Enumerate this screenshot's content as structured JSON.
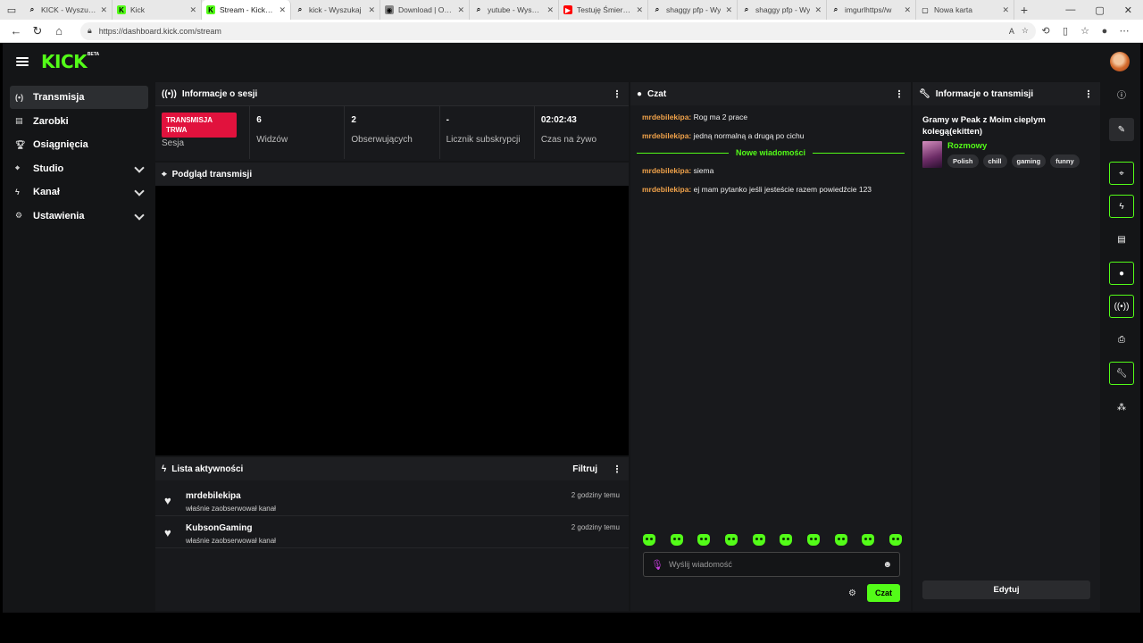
{
  "browser": {
    "tabs": [
      {
        "title": "KICK - Wyszukaj",
        "favicon": "search-icon",
        "color": "#e8e8e8"
      },
      {
        "title": "Kick",
        "favicon": "kick-logo",
        "color": "#53fc18"
      },
      {
        "title": "Stream - Kick Da",
        "favicon": "kick-logo",
        "color": "#53fc18",
        "active": true
      },
      {
        "title": "kick - Wyszukaj",
        "favicon": "search-icon",
        "color": "#e8e8e8"
      },
      {
        "title": "Download | OBS",
        "favicon": "obs-icon",
        "color": "#888888"
      },
      {
        "title": "yutube - Wyszuk",
        "favicon": "search-icon",
        "color": "#e8e8e8"
      },
      {
        "title": "Testuję Śmierci z",
        "favicon": "youtube-icon",
        "color": "#ff0000"
      },
      {
        "title": "shaggy pfp - Wy",
        "favicon": "search-icon",
        "color": "#e8e8e8"
      },
      {
        "title": "shaggy pfp - Wy",
        "favicon": "search-icon",
        "color": "#e8e8e8"
      },
      {
        "title": "imgurlhttps//w",
        "favicon": "search-icon",
        "color": "#e8e8e8"
      },
      {
        "title": "Nowa karta",
        "favicon": "new-tab-icon",
        "color": "#e8e8e8"
      }
    ],
    "url": "https://dashboard.kick.com/stream"
  },
  "logo": {
    "word": "KICK",
    "badge": "BETA"
  },
  "sidebar": {
    "items": [
      {
        "label": "Transmisja",
        "icon": "broadcast-icon",
        "active": true,
        "expandable": false
      },
      {
        "label": "Zarobki",
        "icon": "earnings-icon",
        "active": false,
        "expandable": false
      },
      {
        "label": "Osiągnięcia",
        "icon": "trophy-icon",
        "active": false,
        "expandable": false
      },
      {
        "label": "Studio",
        "icon": "studio-icon",
        "active": false,
        "expandable": true
      },
      {
        "label": "Kanał",
        "icon": "channel-icon",
        "active": false,
        "expandable": true
      },
      {
        "label": "Ustawienia",
        "icon": "settings-icon",
        "active": false,
        "expandable": true
      }
    ]
  },
  "session": {
    "title": "Informacje o sesji",
    "live_badge": "TRANSMISJA TRWA",
    "session_label": "Sesja",
    "stats": [
      {
        "value": "6",
        "label": "Widzów"
      },
      {
        "value": "2",
        "label": "Obserwujących"
      },
      {
        "value": "-",
        "label": "Licznik subskrypcji"
      },
      {
        "value": "02:02:43",
        "label": "Czas na żywo"
      }
    ]
  },
  "preview": {
    "title": "Podgląd transmisji"
  },
  "activity": {
    "title": "Lista aktywności",
    "filter_label": "Filtruj",
    "items": [
      {
        "name": "mrdebilekipa",
        "desc": "właśnie zaobserwował kanał",
        "time": "2 godziny temu"
      },
      {
        "name": "KubsonGaming",
        "desc": "właśnie zaobserwował kanał",
        "time": "2 godziny temu"
      }
    ]
  },
  "chat": {
    "title": "Czat",
    "messages_before": [
      {
        "user": "mrdebilekipa:",
        "text": "Rog ma 2 prace"
      },
      {
        "user": "mrdebilekipa:",
        "text": "jedną normalną a drugą po cichu"
      }
    ],
    "new_messages_label": "Nowe wiadomości",
    "messages_after": [
      {
        "user": "mrdebilekipa:",
        "text": "siema"
      },
      {
        "user": "mrdebilekipa:",
        "text": "ej mam pytanko jeśli jesteście razem powiedźcie 123"
      }
    ],
    "input_placeholder": "Wyślij wiadomość",
    "send_label": "Czat"
  },
  "stream_info": {
    "title": "Informacje o transmisji",
    "stream_title": "Gramy w Peak z Moim cieplym kolegą(ekitten)",
    "category": "Rozmowy",
    "tags": [
      "Polish",
      "chill",
      "gaming",
      "funny"
    ],
    "edit_label": "Edytuj"
  },
  "colors": {
    "accent": "#53fc18",
    "live": "#e1123d",
    "username": "#f0a24a"
  }
}
